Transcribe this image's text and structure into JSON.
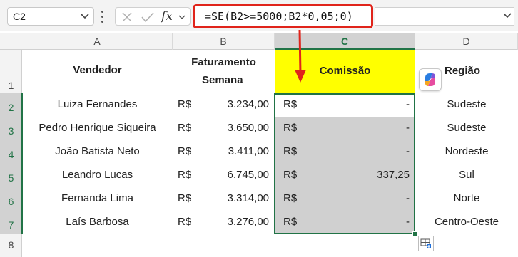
{
  "formula_bar": {
    "name_box": "C2",
    "fx_label": "fx",
    "formula": "=SE(B2>=5000;B2*0,05;0)"
  },
  "columns": [
    "A",
    "B",
    "C",
    "D"
  ],
  "rows": [
    "1",
    "2",
    "3",
    "4",
    "5",
    "6",
    "7",
    "8"
  ],
  "headers": {
    "vendedor": "Vendedor",
    "faturamento_line1": "Faturamento",
    "faturamento_line2": "Semana",
    "comissao": "Comissão",
    "regiao": "Região"
  },
  "currency": "R$",
  "table_rows": [
    {
      "vendedor": "Luiza Fernandes",
      "faturamento": "3.234,00",
      "comissao": "-",
      "regiao": "Sudeste"
    },
    {
      "vendedor": "Pedro Henrique Siqueira",
      "faturamento": "3.650,00",
      "comissao": "-",
      "regiao": "Sudeste"
    },
    {
      "vendedor": "João Batista Neto",
      "faturamento": "3.411,00",
      "comissao": "-",
      "regiao": "Nordeste"
    },
    {
      "vendedor": "Leandro Lucas",
      "faturamento": "6.745,00",
      "comissao": "337,25",
      "regiao": "Sul"
    },
    {
      "vendedor": "Fernanda Lima",
      "faturamento": "3.314,00",
      "comissao": "-",
      "regiao": "Norte"
    },
    {
      "vendedor": "Laís Barbosa",
      "faturamento": "3.276,00",
      "comissao": "-",
      "regiao": "Centro-Oeste"
    }
  ],
  "colors": {
    "highlight": "#ffff00",
    "selection": "#217346",
    "callout": "#e0241b",
    "selected_fill": "#d0d0d0"
  },
  "icons": {
    "name_box_dropdown": "chevron-down-icon",
    "cancel": "close-icon",
    "enter": "check-icon",
    "function": "fx-icon",
    "copilot": "copilot-icon",
    "quick_analysis": "quick-analysis-icon"
  }
}
